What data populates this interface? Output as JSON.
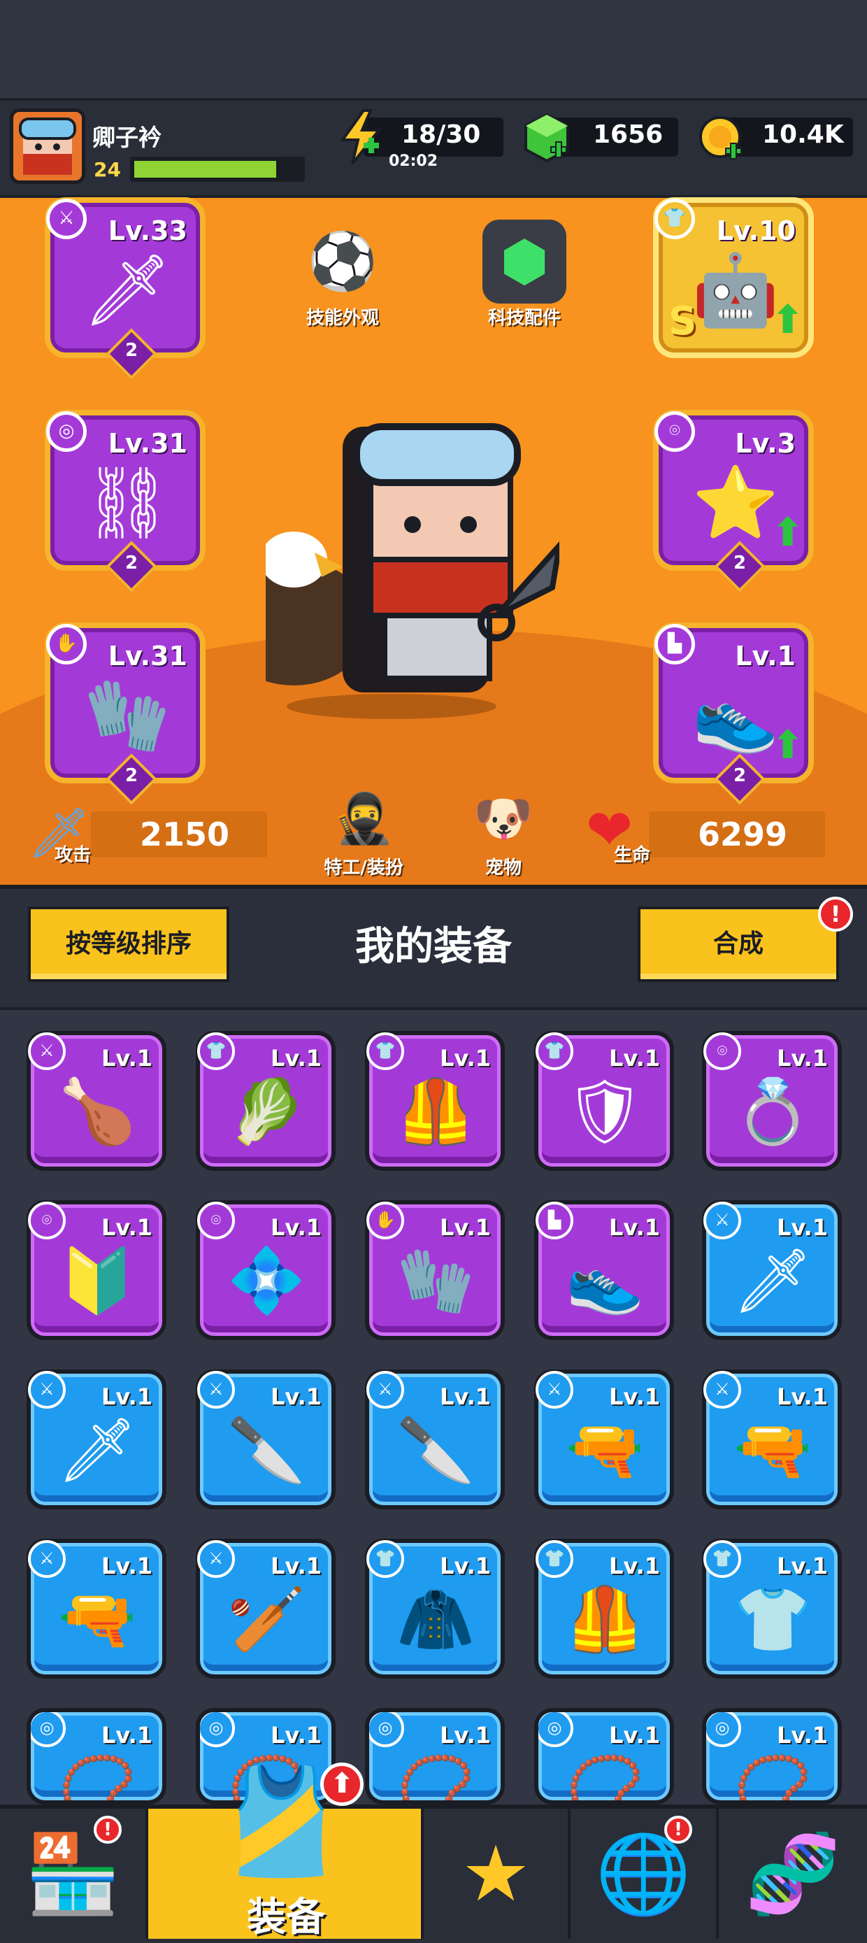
{
  "player": {
    "name": "卿子衿",
    "level": "24",
    "xp_fraction": 0.84
  },
  "resources": {
    "energy": {
      "value": "18/30",
      "timer": "02:02",
      "icon": "energy-bolt-icon"
    },
    "gems": {
      "value": "1656",
      "icon": "green-gem-icon"
    },
    "coins": {
      "value": "10.4K",
      "icon": "gold-coin-icon"
    }
  },
  "hero": {
    "top_buttons": {
      "skill_skin": "技能外观",
      "tech_parts": "科技配件"
    },
    "slots": {
      "weapon": {
        "level": "Lv.33",
        "grade": "2",
        "type_icon": "weapon-icon"
      },
      "armor": {
        "level": "Lv.10",
        "rank": "S",
        "type_icon": "armor-icon",
        "upgrade": true
      },
      "necklace": {
        "level": "Lv.31",
        "grade": "2",
        "type_icon": "necklace-icon"
      },
      "belt": {
        "level": "Lv.3",
        "grade": "2",
        "type_icon": "belt-icon",
        "upgrade": true
      },
      "gloves": {
        "level": "Lv.31",
        "grade": "2",
        "type_icon": "glove-icon"
      },
      "boots": {
        "level": "Lv.1",
        "grade": "2",
        "type_icon": "boot-icon",
        "upgrade": true
      }
    },
    "attack": {
      "label": "攻击",
      "value": "2150"
    },
    "health": {
      "label": "生命",
      "value": "6299"
    },
    "agent_label": "特工/装扮",
    "pet_label": "宠物"
  },
  "equipment": {
    "title": "我的装备",
    "sort_button": "按等级排序",
    "merge_button": "合成",
    "items": [
      {
        "level": "Lv.1",
        "rarity": "purple",
        "type_icon": "weapon-icon",
        "art": "🍗"
      },
      {
        "level": "Lv.1",
        "rarity": "purple",
        "type_icon": "armor-icon",
        "art": "🥬"
      },
      {
        "level": "Lv.1",
        "rarity": "purple",
        "type_icon": "armor-icon",
        "art": "🦺"
      },
      {
        "level": "Lv.1",
        "rarity": "purple",
        "type_icon": "armor-icon",
        "art": "🛡"
      },
      {
        "level": "Lv.1",
        "rarity": "purple",
        "type_icon": "belt-icon",
        "art": "💍"
      },
      {
        "level": "Lv.1",
        "rarity": "purple",
        "type_icon": "belt-icon",
        "art": "🔰"
      },
      {
        "level": "Lv.1",
        "rarity": "purple",
        "type_icon": "belt-icon",
        "art": "💠"
      },
      {
        "level": "Lv.1",
        "rarity": "purple",
        "type_icon": "glove-icon",
        "art": "🧤"
      },
      {
        "level": "Lv.1",
        "rarity": "purple",
        "type_icon": "boot-icon",
        "art": "👟"
      },
      {
        "level": "Lv.1",
        "rarity": "blue",
        "type_icon": "weapon-icon",
        "art": "🗡"
      },
      {
        "level": "Lv.1",
        "rarity": "blue",
        "type_icon": "weapon-icon",
        "art": "🗡"
      },
      {
        "level": "Lv.1",
        "rarity": "blue",
        "type_icon": "weapon-icon",
        "art": "🔪"
      },
      {
        "level": "Lv.1",
        "rarity": "blue",
        "type_icon": "weapon-icon",
        "art": "🔪"
      },
      {
        "level": "Lv.1",
        "rarity": "blue",
        "type_icon": "weapon-icon",
        "art": "🔫"
      },
      {
        "level": "Lv.1",
        "rarity": "blue",
        "type_icon": "weapon-icon",
        "art": "🔫"
      },
      {
        "level": "Lv.1",
        "rarity": "blue",
        "type_icon": "weapon-icon",
        "art": "🔫"
      },
      {
        "level": "Lv.1",
        "rarity": "blue",
        "type_icon": "weapon-icon",
        "art": "🏏"
      },
      {
        "level": "Lv.1",
        "rarity": "blue",
        "type_icon": "armor-icon",
        "art": "🧥"
      },
      {
        "level": "Lv.1",
        "rarity": "blue",
        "type_icon": "armor-icon",
        "art": "🦺"
      },
      {
        "level": "Lv.1",
        "rarity": "blue",
        "type_icon": "armor-icon",
        "art": "👕"
      },
      {
        "level": "Lv.1",
        "rarity": "blue",
        "type_icon": "necklace-icon",
        "art": "📿"
      },
      {
        "level": "Lv.1",
        "rarity": "blue",
        "type_icon": "necklace-icon",
        "art": "📿"
      },
      {
        "level": "Lv.1",
        "rarity": "blue",
        "type_icon": "necklace-icon",
        "art": "📿"
      },
      {
        "level": "Lv.1",
        "rarity": "blue",
        "type_icon": "necklace-icon",
        "art": "📿"
      },
      {
        "level": "Lv.1",
        "rarity": "blue",
        "type_icon": "necklace-icon",
        "art": "📿"
      }
    ]
  },
  "nav": {
    "shop": {
      "icon": "shop-icon",
      "badge": "!"
    },
    "equipment": {
      "label": "装备",
      "icon": "equipment-icon"
    },
    "battle": {
      "icon": "battle-star-icon"
    },
    "events": {
      "icon": "stars-planet-icon",
      "badge": "!"
    },
    "lab": {
      "icon": "dna-battery-icon"
    }
  },
  "colors": {
    "orange": "#f7931e",
    "purple": "#a33ad8",
    "blue": "#1f9bf0",
    "yellow": "#f9c21d",
    "green": "#2dc53f"
  }
}
